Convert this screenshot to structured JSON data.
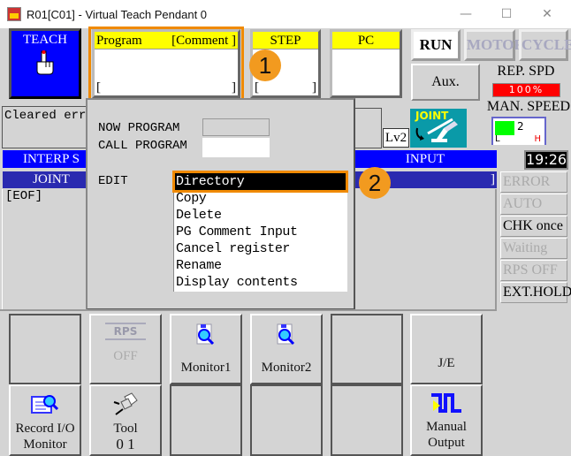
{
  "window": {
    "title": "R01[C01] - Virtual Teach Pendant 0",
    "controls": {
      "minimize": "—",
      "maximize": "☐",
      "close": "✕"
    }
  },
  "mode": {
    "label": "TEACH",
    "icon": "hand-pointer-icon"
  },
  "program_panel": {
    "header_left": "Program",
    "header_right": "[Comment ]",
    "bracket_open": "[",
    "bracket_close": "]"
  },
  "step_panel": {
    "header": "STEP",
    "bracket_open": "[",
    "bracket_close": "]"
  },
  "pc_panel": {
    "header": "PC"
  },
  "status_buttons": {
    "run": "RUN",
    "motor": "MOTOR",
    "cycle": "CYCLE",
    "aux": "Aux."
  },
  "rep_speed": {
    "label": "REP. SPD",
    "value": "100%",
    "color": "#ff0000"
  },
  "man_speed": {
    "label": "MAN. SPEED",
    "level": 2,
    "max": 5,
    "low_label": "L",
    "high_label": "H",
    "fill_color": "#00ff00"
  },
  "level": "Lv2",
  "joint_mode": {
    "label": "JOINT"
  },
  "message": "Cleared erro",
  "interp_bar": "INTERP S",
  "joint_bar": "JOINT",
  "input_bar": "INPUT",
  "input_field": {
    "bracket_close": "]"
  },
  "clock": "19:26",
  "program_lines": [
    "[EOF]"
  ],
  "status_flags": [
    {
      "label": "ERROR",
      "active": false
    },
    {
      "label": "AUTO",
      "active": false
    },
    {
      "label": "CHK once",
      "active": true
    },
    {
      "label": "Waiting",
      "active": false
    },
    {
      "label": "RPS OFF",
      "active": false
    },
    {
      "label": "EXT.HOLD",
      "active": true
    }
  ],
  "popup": {
    "now_program_label": "NOW PROGRAM",
    "now_program_value": "",
    "call_program_label": "CALL PROGRAM",
    "call_program_value": "",
    "edit_label": "EDIT",
    "menu_items": [
      "Directory",
      "Copy",
      "Delete",
      "PG Comment Input",
      "Cancel register",
      "Rename",
      "Display contents"
    ],
    "selected_index": 0
  },
  "annotations": {
    "step1": "1",
    "step2": "2",
    "highlight_color": "#f08a00"
  },
  "function_keys": {
    "row1": [
      {
        "label": "",
        "icon": ""
      },
      {
        "label": "OFF",
        "icon": "rps-icon",
        "icon_text": "RPS",
        "disabled": true
      },
      {
        "label": "Monitor1",
        "icon": "monitor-magnifier-icon"
      },
      {
        "label": "Monitor2",
        "icon": "monitor-magnifier-icon"
      },
      {
        "label": "",
        "icon": ""
      },
      {
        "label": "J/E",
        "icon": ""
      }
    ],
    "row2": [
      {
        "label": "Record I/O",
        "label2": "Monitor",
        "icon": "record-io-monitor-icon"
      },
      {
        "label": "Tool",
        "label2": "0 1",
        "icon": "tool-plug-icon"
      },
      {
        "label": "",
        "icon": ""
      },
      {
        "label": "",
        "icon": ""
      },
      {
        "label": "",
        "icon": ""
      },
      {
        "label": "Manual",
        "label2": "Output",
        "icon": "manual-output-signal-icon"
      }
    ]
  }
}
